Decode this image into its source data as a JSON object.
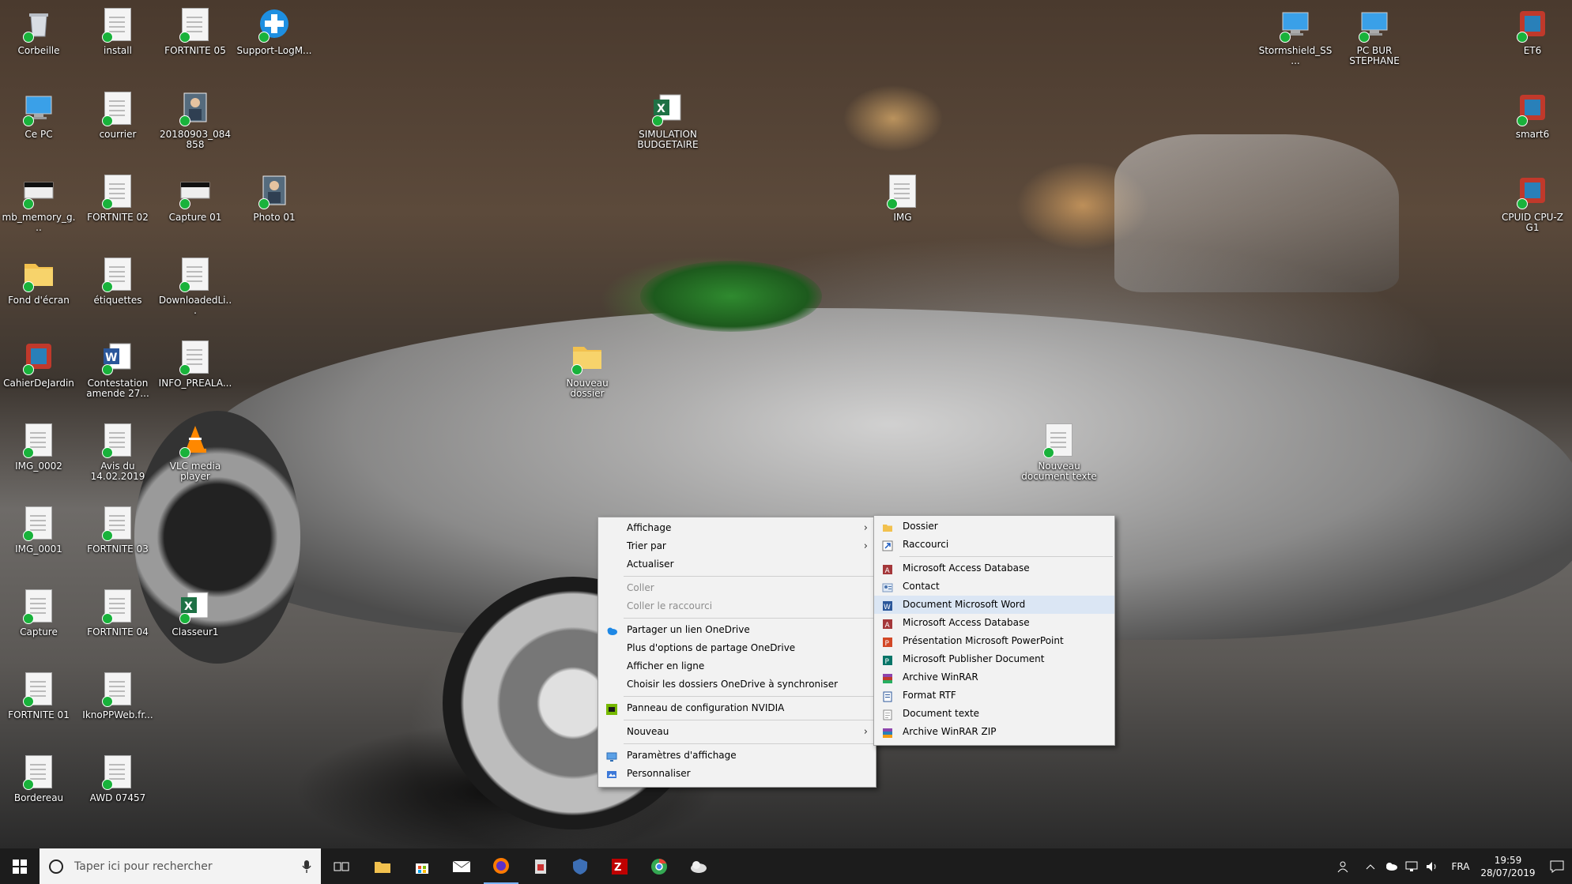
{
  "desktop": {
    "icons": [
      {
        "label": "Corbeille",
        "kind": "recycle"
      },
      {
        "label": "install",
        "kind": "doc"
      },
      {
        "label": "FORTNITE 05",
        "kind": "doc"
      },
      {
        "label": "Support-LogM...",
        "kind": "support"
      },
      {
        "label": "Ce PC",
        "kind": "pc"
      },
      {
        "label": "courrier",
        "kind": "doc"
      },
      {
        "label": "20180903_084858",
        "kind": "photo"
      },
      {
        "label": "SIMULATION BUDGETAIRE",
        "kind": "excel"
      },
      {
        "label": "mb_memory_g...",
        "kind": "screen"
      },
      {
        "label": "FORTNITE 02",
        "kind": "doc"
      },
      {
        "label": "Capture 01",
        "kind": "screen"
      },
      {
        "label": "Photo 01",
        "kind": "photo"
      },
      {
        "label": "IMG",
        "kind": "doc"
      },
      {
        "label": "Fond d'écran",
        "kind": "folder"
      },
      {
        "label": "étiquettes",
        "kind": "doc"
      },
      {
        "label": "DownloadedLi...",
        "kind": "doc"
      },
      {
        "label": "CahierDeJardin",
        "kind": "app"
      },
      {
        "label": "Contestation amende 27...",
        "kind": "word"
      },
      {
        "label": "INFO_PREALA...",
        "kind": "doc"
      },
      {
        "label": "Nouveau dossier",
        "kind": "folder"
      },
      {
        "label": "IMG_0002",
        "kind": "doc"
      },
      {
        "label": "Avis du 14.02.2019",
        "kind": "doc"
      },
      {
        "label": "VLC media player",
        "kind": "vlc"
      },
      {
        "label": "Nouveau document texte",
        "kind": "doc"
      },
      {
        "label": "IMG_0001",
        "kind": "doc"
      },
      {
        "label": "FORTNITE 03",
        "kind": "doc"
      },
      {
        "label": "Capture",
        "kind": "doc"
      },
      {
        "label": "FORTNITE 04",
        "kind": "doc"
      },
      {
        "label": "Classeur1",
        "kind": "excel"
      },
      {
        "label": "FORTNITE 01",
        "kind": "doc"
      },
      {
        "label": "IknoPPWeb.fr...",
        "kind": "doc"
      },
      {
        "label": "Bordereau",
        "kind": "doc"
      },
      {
        "label": "AWD 07457",
        "kind": "doc"
      },
      {
        "label": "Stormshield_SS...",
        "kind": "pc"
      },
      {
        "label": "PC BUR STEPHANE",
        "kind": "pc"
      },
      {
        "label": "ET6",
        "kind": "app"
      },
      {
        "label": "smart6",
        "kind": "app"
      },
      {
        "label": "CPUID CPU-Z G1",
        "kind": "app"
      }
    ]
  },
  "context_menu": {
    "items": [
      {
        "label": "Affichage",
        "submenu": true
      },
      {
        "label": "Trier par",
        "submenu": true
      },
      {
        "label": "Actualiser"
      },
      {
        "label": "Coller",
        "disabled": true
      },
      {
        "label": "Coller le raccourci",
        "disabled": true
      },
      {
        "label": "Partager un lien OneDrive",
        "icon": "onedrive-icon"
      },
      {
        "label": "Plus d'options de partage OneDrive"
      },
      {
        "label": "Afficher en ligne"
      },
      {
        "label": "Choisir les dossiers OneDrive à synchroniser"
      },
      {
        "label": "Panneau de configuration NVIDIA",
        "icon": "nvidia-icon"
      },
      {
        "label": "Nouveau",
        "submenu": true
      },
      {
        "label": "Paramètres d'affichage",
        "icon": "display-icon"
      },
      {
        "label": "Personnaliser",
        "icon": "personalize-icon"
      }
    ]
  },
  "new_submenu": {
    "items": [
      {
        "label": "Dossier",
        "icon": "folder-icon"
      },
      {
        "label": "Raccourci",
        "icon": "shortcut-icon"
      },
      {
        "label": "Microsoft Access Database",
        "icon": "access-icon"
      },
      {
        "label": "Contact",
        "icon": "contact-icon"
      },
      {
        "label": "Document Microsoft Word",
        "icon": "word-icon",
        "highlighted": true
      },
      {
        "label": "Microsoft Access Database",
        "icon": "access-icon"
      },
      {
        "label": "Présentation Microsoft PowerPoint",
        "icon": "powerpoint-icon"
      },
      {
        "label": "Microsoft Publisher Document",
        "icon": "publisher-icon"
      },
      {
        "label": "Archive WinRAR",
        "icon": "winrar-icon"
      },
      {
        "label": "Format RTF",
        "icon": "rtf-icon"
      },
      {
        "label": "Document texte",
        "icon": "text-document-icon"
      },
      {
        "label": "Archive WinRAR ZIP",
        "icon": "winrar-zip-icon"
      }
    ]
  },
  "taskbar": {
    "search_placeholder": "Taper ici pour rechercher",
    "language": "FRA",
    "time": "19:59",
    "date": "28/07/2019"
  },
  "colors": {
    "taskbar": "#1c1c1c",
    "menu_bg": "#f2f2f2",
    "highlight": "#dbe6f4",
    "sync_green": "#19b23b"
  }
}
